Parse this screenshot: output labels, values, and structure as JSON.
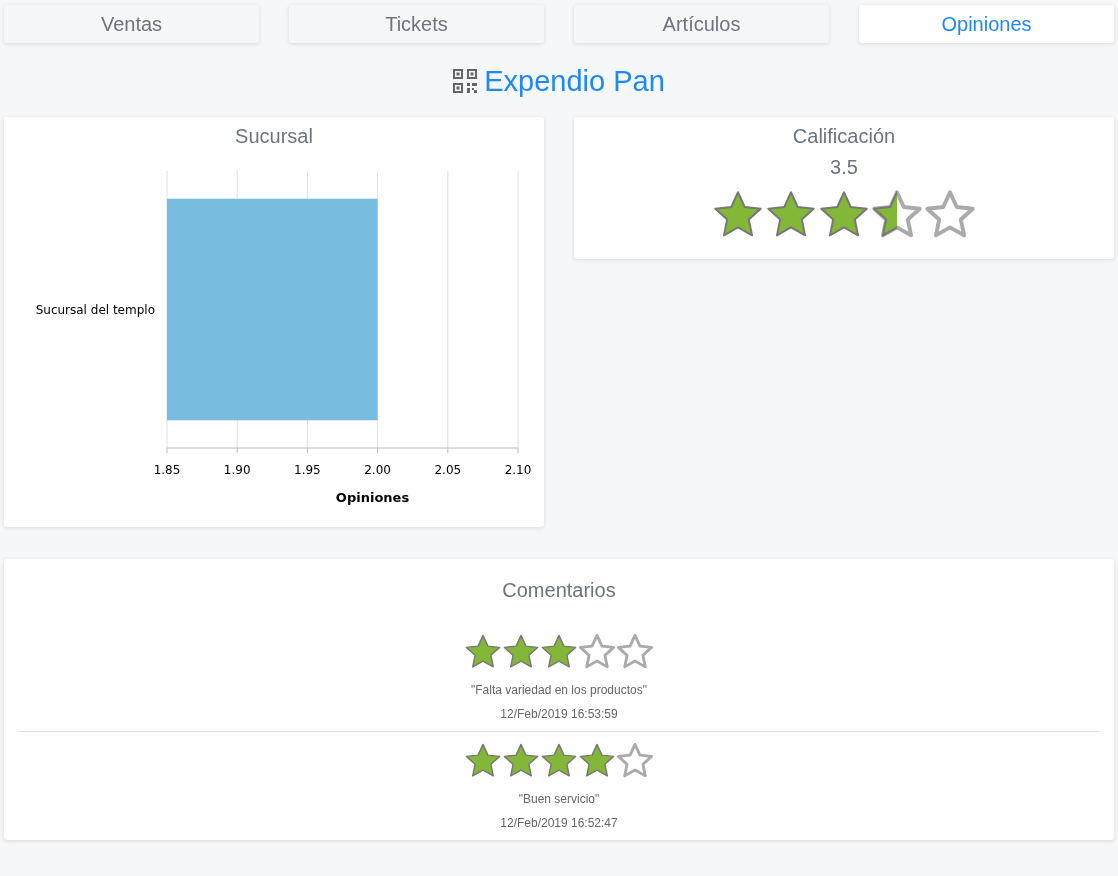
{
  "tabs": [
    {
      "label": "Ventas",
      "selected": false
    },
    {
      "label": "Tickets",
      "selected": false
    },
    {
      "label": "Artículos",
      "selected": false
    },
    {
      "label": "Opiniones",
      "selected": true
    }
  ],
  "title": "Expendio Pan",
  "branch_card": {
    "chart_data": {
      "type": "bar",
      "orientation": "horizontal",
      "grid": true,
      "title": "Sucursal",
      "xlabel": "Opiniones",
      "categories": [
        "Sucursal del templo"
      ],
      "values": [
        2.0
      ],
      "xlim": [
        1.85,
        2.1
      ],
      "xticks": [
        {
          "value": 1.85,
          "label": "1.85"
        },
        {
          "value": 1.9,
          "label": "1.90"
        },
        {
          "value": 1.95,
          "label": "1.95"
        },
        {
          "value": 2.0,
          "label": "2.00"
        },
        {
          "value": 2.05,
          "label": "2.05"
        },
        {
          "value": 2.1,
          "label": "2.10"
        }
      ]
    }
  },
  "rating_card": {
    "title": "Calificación",
    "value": "3.5",
    "stars": 3.5
  },
  "comments": {
    "title": "Comentarios",
    "items": [
      {
        "stars": 3,
        "text": "\"Falta variedad en los productos\"",
        "date": "12/Feb/2019 16:53:59"
      },
      {
        "stars": 4,
        "text": "\"Buen servicio\"",
        "date": "12/Feb/2019 16:52:47"
      }
    ]
  }
}
